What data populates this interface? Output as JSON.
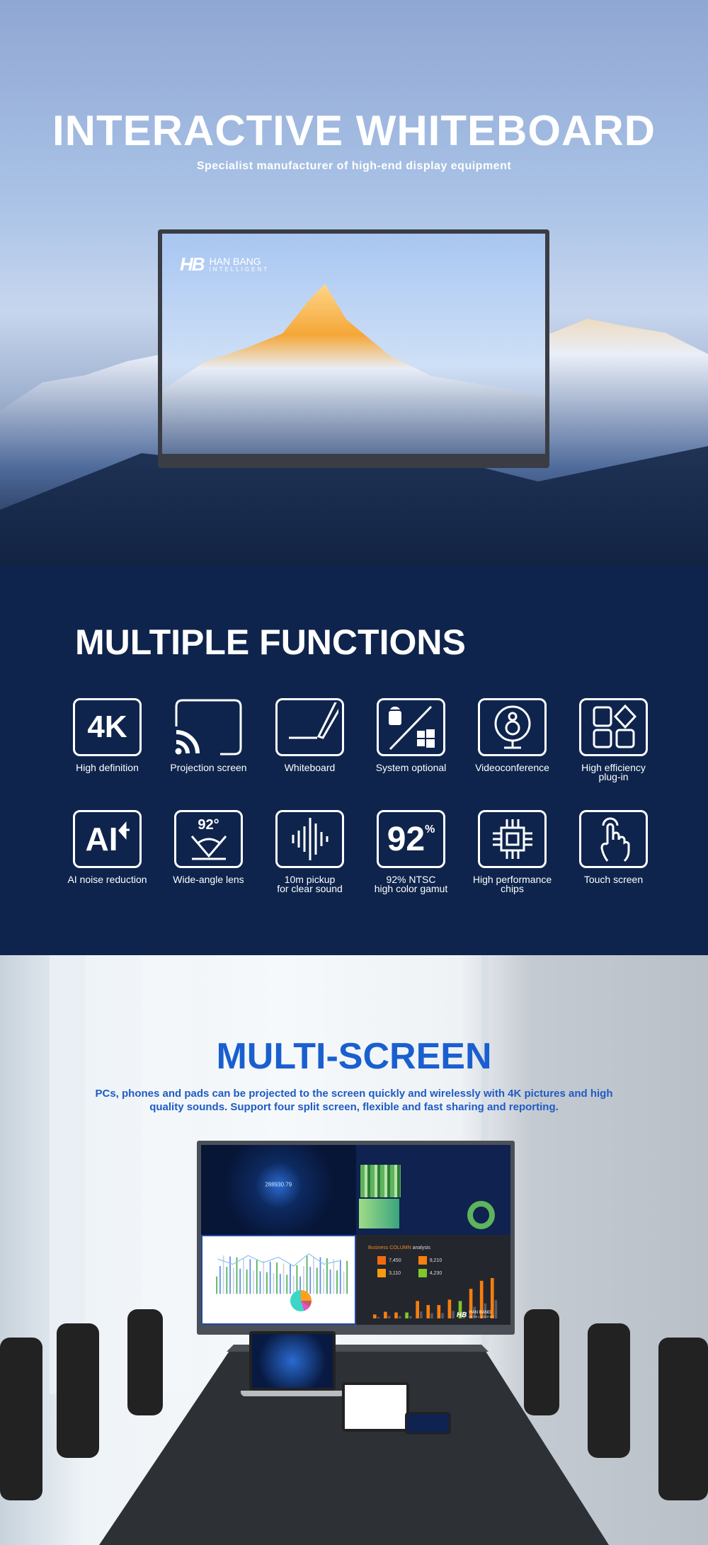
{
  "hero": {
    "title": "INTERACTIVE WHITEBOARD",
    "subtitle": "Specialist manufacturer of high-end display equipment",
    "logo": {
      "mark": "HB",
      "name": "HAN BANG",
      "tagline": "INTELLIGENT"
    }
  },
  "functions": {
    "title": "MULTIPLE FUNCTIONS",
    "items": [
      {
        "label": "High definition",
        "icon": "4k-icon",
        "glyph": "4K"
      },
      {
        "label": "Projection screen",
        "icon": "cast-icon"
      },
      {
        "label": "Whiteboard",
        "icon": "pen-icon"
      },
      {
        "label": "System optional",
        "icon": "android-windows-icon"
      },
      {
        "label": "Videoconference",
        "icon": "webcam-icon"
      },
      {
        "label": "High efficiency\nplug-in",
        "icon": "apps-icon"
      },
      {
        "label": "AI noise reduction",
        "icon": "ai-icon",
        "glyph": "AI"
      },
      {
        "label": "Wide-angle lens",
        "icon": "wide-angle-icon",
        "glyph": "92°"
      },
      {
        "label": "10m pickup\nfor clear sound",
        "icon": "sound-wave-icon"
      },
      {
        "label": "92% NTSC\nhigh color gamut",
        "icon": "color-gamut-icon",
        "glyph": "92",
        "sup": "%"
      },
      {
        "label": "High performance\nchips",
        "icon": "chip-icon"
      },
      {
        "label": "Touch screen",
        "icon": "touch-icon"
      }
    ]
  },
  "multiscreen": {
    "title": "MULTI-SCREEN",
    "description": "PCs, phones and pads can be projected to the screen quickly and wirelessly with 4K pictures and high quality sounds. Support four split screen, flexible and fast sharing and reporting.",
    "dashboard": {
      "globe_value": "288930.79",
      "column_title_a": "Business COLUMN",
      "column_title_b": " analysis",
      "stats": [
        {
          "value": "7,450",
          "color": "#f26a0f"
        },
        {
          "value": "9,210",
          "color": "#f57f10"
        },
        {
          "value": "3,110",
          "color": "#f89a10"
        },
        {
          "value": "4,230",
          "color": "#7ec62a"
        }
      ],
      "logo": {
        "mark": "HB",
        "name": "HAN BANG",
        "tagline": "INTELLIGENT"
      }
    }
  },
  "colors": {
    "navy": "#0e244c",
    "accent_blue": "#1a5fd0"
  }
}
